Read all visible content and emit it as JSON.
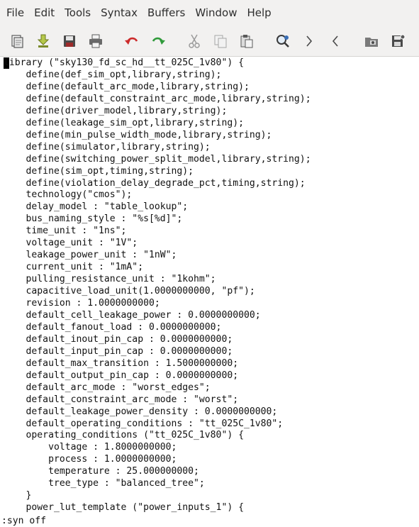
{
  "menu": [
    "File",
    "Edit",
    "Tools",
    "Syntax",
    "Buffers",
    "Window",
    "Help"
  ],
  "toolbar": [
    {
      "name": "open-icon"
    },
    {
      "name": "load-session-icon"
    },
    {
      "name": "save-icon"
    },
    {
      "name": "print-icon"
    },
    {
      "name": "undo-icon"
    },
    {
      "name": "redo-icon"
    },
    {
      "name": "cut-icon"
    },
    {
      "name": "copy-icon"
    },
    {
      "name": "paste-icon"
    },
    {
      "name": "find-replace-icon"
    },
    {
      "name": "find-next-icon"
    },
    {
      "name": "find-previous-icon"
    },
    {
      "name": "load-script-icon"
    },
    {
      "name": "save-script-icon"
    }
  ],
  "colors": {
    "chrome_bg": "#f2f1f0",
    "undo_red": "#cc2b2b",
    "redo_green": "#2f9a3a",
    "text": "#111111"
  },
  "editor": {
    "lines": [
      "library (\"sky130_fd_sc_hd__tt_025C_1v80\") {",
      "    define(def_sim_opt,library,string);",
      "    define(default_arc_mode,library,string);",
      "    define(default_constraint_arc_mode,library,string);",
      "    define(driver_model,library,string);",
      "    define(leakage_sim_opt,library,string);",
      "    define(min_pulse_width_mode,library,string);",
      "    define(simulator,library,string);",
      "    define(switching_power_split_model,library,string);",
      "    define(sim_opt,timing,string);",
      "    define(violation_delay_degrade_pct,timing,string);",
      "    technology(\"cmos\");",
      "    delay_model : \"table_lookup\";",
      "    bus_naming_style : \"%s[%d]\";",
      "    time_unit : \"1ns\";",
      "    voltage_unit : \"1V\";",
      "    leakage_power_unit : \"1nW\";",
      "    current_unit : \"1mA\";",
      "    pulling_resistance_unit : \"1kohm\";",
      "    capacitive_load_unit(1.0000000000, \"pf\");",
      "    revision : 1.0000000000;",
      "    default_cell_leakage_power : 0.0000000000;",
      "    default_fanout_load : 0.0000000000;",
      "    default_inout_pin_cap : 0.0000000000;",
      "    default_input_pin_cap : 0.0000000000;",
      "    default_max_transition : 1.5000000000;",
      "    default_output_pin_cap : 0.0000000000;",
      "    default_arc_mode : \"worst_edges\";",
      "    default_constraint_arc_mode : \"worst\";",
      "    default_leakage_power_density : 0.0000000000;",
      "    default_operating_conditions : \"tt_025C_1v80\";",
      "    operating_conditions (\"tt_025C_1v80\") {",
      "        voltage : 1.8000000000;",
      "        process : 1.0000000000;",
      "        temperature : 25.000000000;",
      "        tree_type : \"balanced_tree\";",
      "    }",
      "    power_lut_template (\"power_inputs_1\") {"
    ]
  },
  "command_line": ":syn off"
}
